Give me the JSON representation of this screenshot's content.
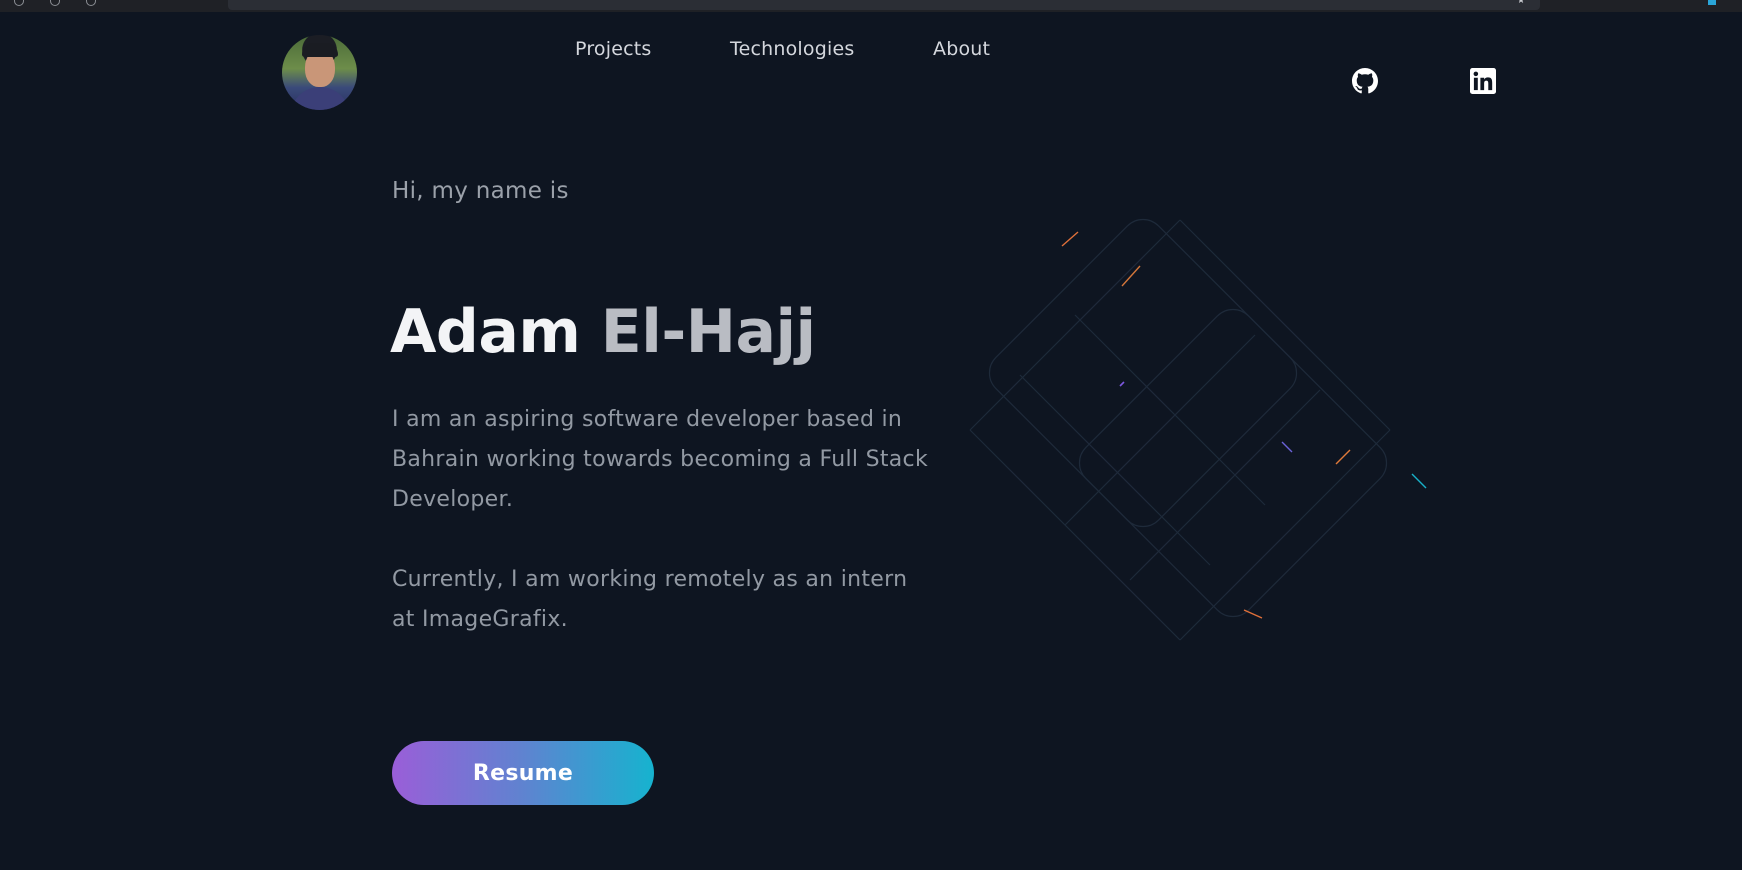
{
  "nav": {
    "links": [
      {
        "label": "Projects"
      },
      {
        "label": "Technologies"
      },
      {
        "label": "About"
      }
    ],
    "social": [
      {
        "icon": "github-icon"
      },
      {
        "icon": "linkedin-icon"
      }
    ]
  },
  "hero": {
    "greeting": "Hi, my name is",
    "first_name": "Adam",
    "last_name": "El-Hajj",
    "bio_1": "I am an aspiring software developer based in Bahrain working towards becoming a Full Stack Developer.",
    "bio_2": "Currently, I am working remotely as an intern at ImageGrafix.",
    "resume_label": "Resume"
  },
  "colors": {
    "background": "#0e1521",
    "gradient_start": "#9a5ed8",
    "gradient_end": "#16b3cf"
  }
}
